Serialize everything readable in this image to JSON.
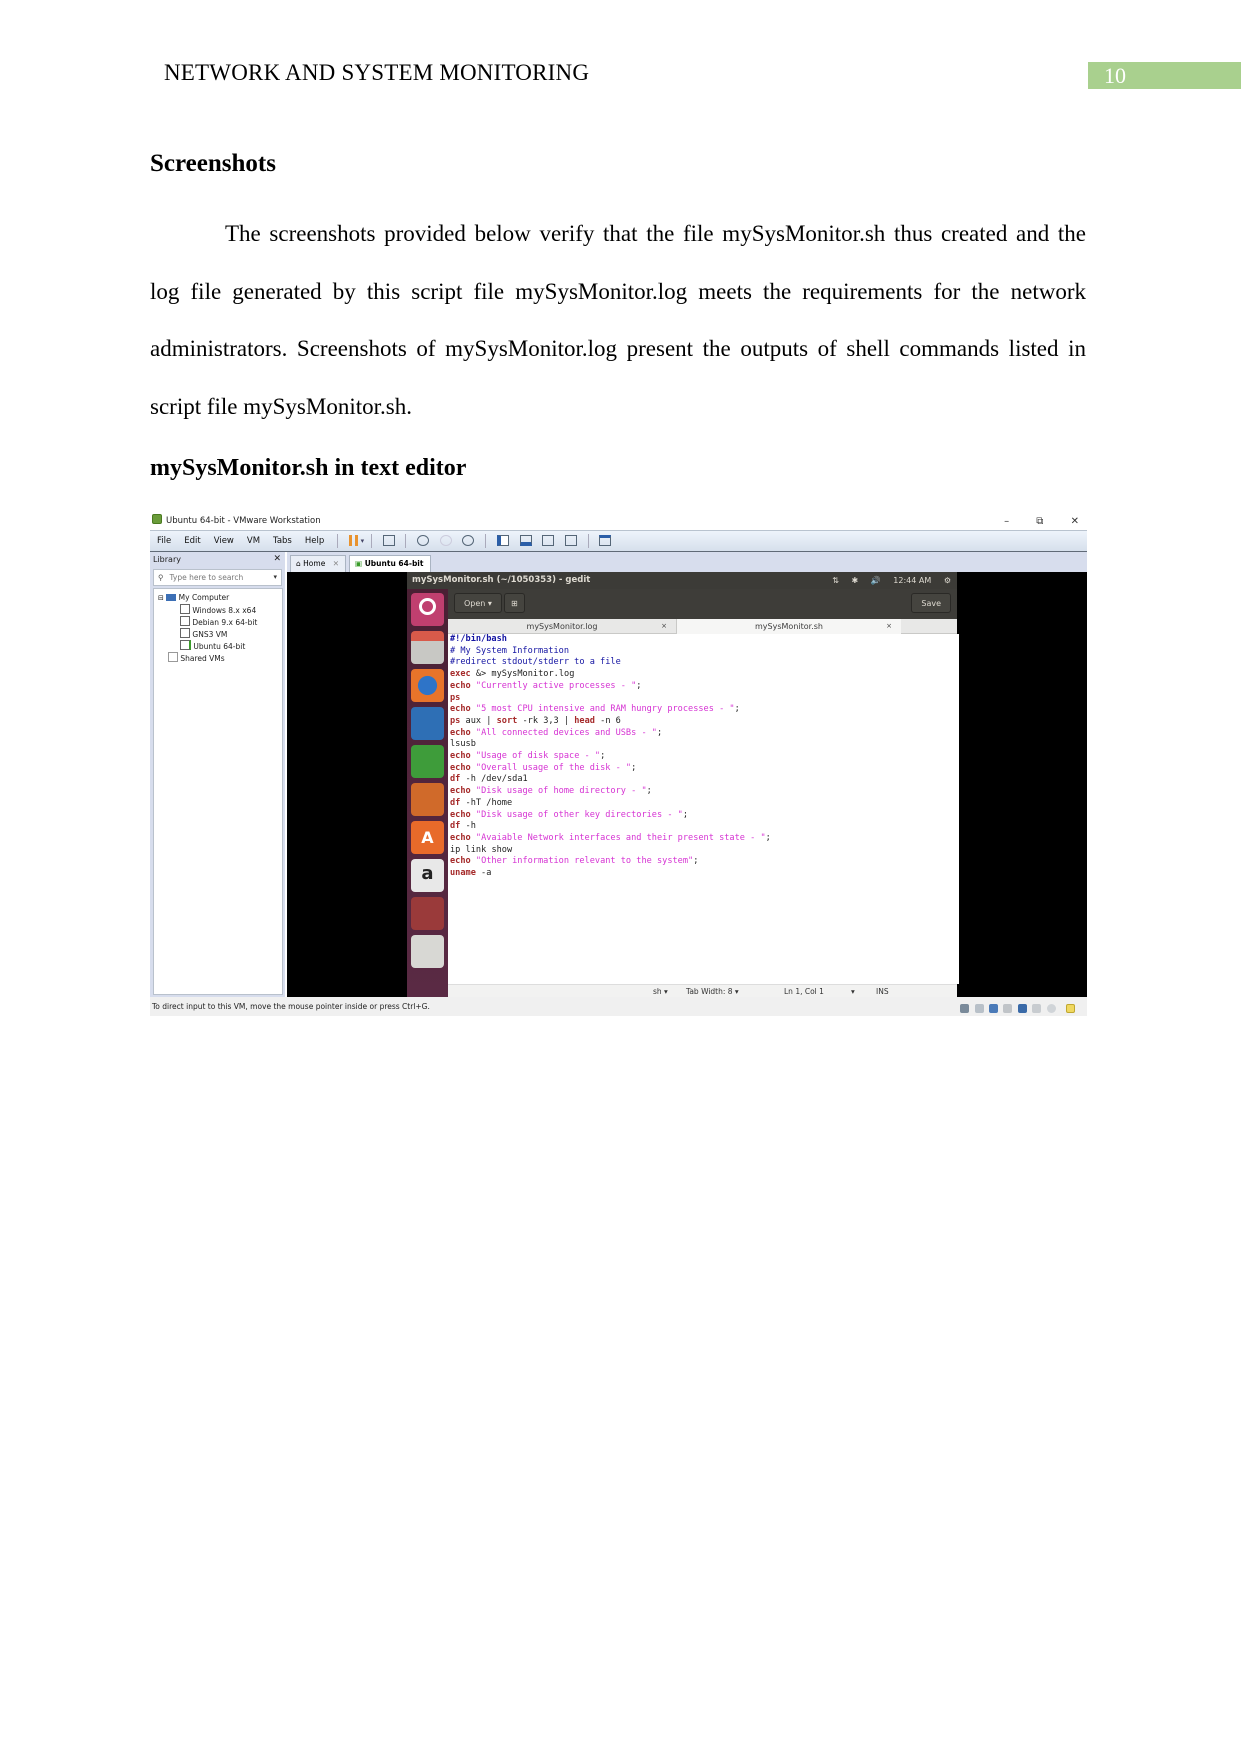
{
  "header": {
    "title": "NETWORK AND SYSTEM MONITORING",
    "page_number": "10"
  },
  "section": {
    "heading": "Screenshots",
    "paragraph": "The screenshots provided below verify that the file mySysMonitor.sh thus created and the log file generated by this script file mySysMonitor.log meets the requirements for the network administrators. Screenshots of mySysMonitor.log present the outputs of shell commands listed in script file mySysMonitor.sh.",
    "subheading": "mySysMonitor.sh in text editor"
  },
  "vmware": {
    "window_title": "Ubuntu 64-bit - VMware Workstation",
    "controls": {
      "minimize": "–",
      "restore": "⧉",
      "close": "✕"
    },
    "menu": [
      "File",
      "Edit",
      "View",
      "VM",
      "Tabs",
      "Help"
    ],
    "library": {
      "title": "Library",
      "close": "✕",
      "search_placeholder": "Type here to search",
      "tree": [
        {
          "label": "My Computer",
          "level": 0
        },
        {
          "label": "Windows 8.x x64",
          "level": 1
        },
        {
          "label": "Debian 9.x 64-bit",
          "level": 1
        },
        {
          "label": "GNS3 VM",
          "level": 1
        },
        {
          "label": "Ubuntu 64-bit",
          "level": 1
        },
        {
          "label": "Shared VMs",
          "level": 0
        }
      ]
    },
    "tabs": [
      {
        "label": "Home",
        "close": "✕"
      },
      {
        "label": "Ubuntu 64-bit",
        "close": "✕"
      }
    ],
    "status_text": "To direct input to this VM, move the mouse pointer inside or press Ctrl+G."
  },
  "ubuntu": {
    "window_title": "mySysMonitor.sh (~/1050353) - gedit",
    "indicators": {
      "network": "⇅",
      "bluetooth": "✱",
      "volume": "🔊",
      "time": "12:44 AM",
      "settings": "⚙"
    },
    "gedit": {
      "open_label": "Open ▾",
      "new_tab_label": "⊞",
      "save_label": "Save",
      "tabs": [
        {
          "label": "mySysMonitor.log",
          "close": "×"
        },
        {
          "label": "mySysMonitor.sh",
          "close": "×"
        }
      ],
      "code_lines": [
        "#!/bin/bash",
        "# My System Information",
        "#redirect stdout/stderr to a file",
        "exec &> mySysMonitor.log",
        "echo \"Currently active processes - \";",
        "ps",
        "echo \"5 most CPU intensive and RAM hungry processes - \";",
        "ps aux | sort -rk 3,3 | head -n 6",
        "echo \"All connected devices and USBs - \";",
        "lsusb",
        "echo \"Usage of disk space - \";",
        "echo \"Overall usage of the disk - \";",
        "df -h /dev/sda1",
        "echo \"Disk usage of home directory - \";",
        "df -hT /home",
        "echo \"Disk usage of other key directories - \";",
        "df -h",
        "echo \"Avaiable Network interfaces and their present state - \";",
        "ip link show",
        "echo \"Other information relevant to the system\";",
        "uname -a"
      ],
      "footer": {
        "language": "sh ▾",
        "tab_width": "Tab Width: 8 ▾",
        "position": "Ln 1, Col 1",
        "dropdown": "▾",
        "mode": "INS"
      }
    }
  }
}
